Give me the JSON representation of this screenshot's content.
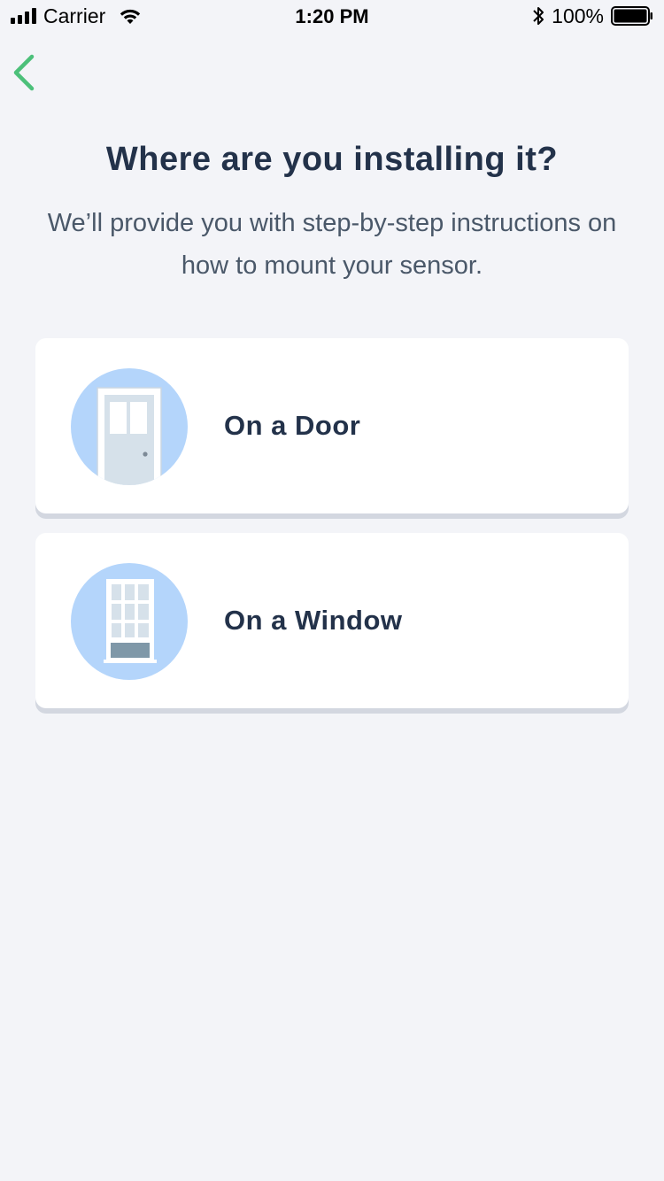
{
  "status_bar": {
    "carrier": "Carrier",
    "time": "1:20 PM",
    "battery": "100%"
  },
  "nav": {
    "back_icon": "chevron-left-icon",
    "accent_color": "#4cc07a"
  },
  "header": {
    "title": "Where are you installing it?",
    "subtitle": "We’ll provide you with step-by-step instructions on how to mount your sensor."
  },
  "options": [
    {
      "label": "On a Door",
      "icon": "door-icon"
    },
    {
      "label": "On a Window",
      "icon": "window-icon"
    }
  ],
  "colors": {
    "background": "#f3f4f8",
    "card": "#ffffff",
    "illustration_circle": "#b4d5fb",
    "text_primary": "#23324a",
    "text_secondary": "#4a5869"
  }
}
